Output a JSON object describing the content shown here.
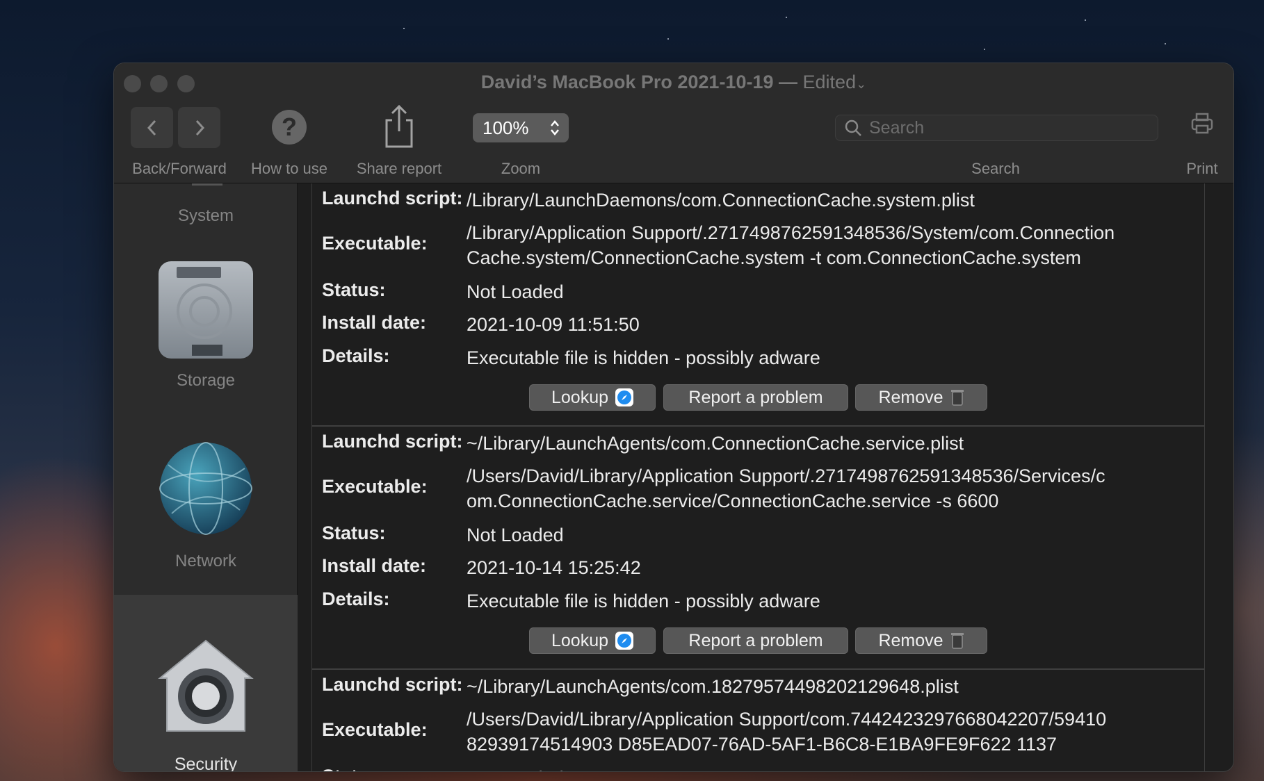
{
  "window": {
    "title": "David’s MacBook Pro 2021-10-19",
    "title_separator": "—",
    "edited_label": "Edited"
  },
  "toolbar": {
    "back_forward_label": "Back/Forward",
    "help_label": "How to use",
    "share_label": "Share report",
    "zoom_label": "Zoom",
    "zoom_value": "100%",
    "search_label": "Search",
    "search_placeholder": "Search",
    "print_label": "Print"
  },
  "sidebar": {
    "items": [
      {
        "label": "System",
        "icon": "system-icon"
      },
      {
        "label": "Storage",
        "icon": "hard-drive-icon"
      },
      {
        "label": "Network",
        "icon": "globe-icon"
      },
      {
        "label": "Security",
        "icon": "security-house-icon",
        "selected": true
      }
    ]
  },
  "labels": {
    "launchd_script": "Launchd script:",
    "executable": "Executable:",
    "status": "Status:",
    "install_date": "Install date:",
    "details": "Details:"
  },
  "buttons": {
    "lookup": "Lookup",
    "report": "Report a problem",
    "remove": "Remove"
  },
  "entries": [
    {
      "launchd_script": "/Library/LaunchDaemons/com.ConnectionCache.system.plist",
      "executable_line1": "/Library/Application Support/.2717498762591348536/System/com.Connection",
      "executable_line2": "Cache.system/ConnectionCache.system -t com.ConnectionCache.system",
      "status": "Not Loaded",
      "install_date": "2021-10-09 11:51:50",
      "details": "Executable file is hidden - possibly adware"
    },
    {
      "launchd_script": "~/Library/LaunchAgents/com.ConnectionCache.service.plist",
      "executable_line1": "/Users/David/Library/Application Support/.2717498762591348536/Services/c",
      "executable_line2": "om.ConnectionCache.service/ConnectionCache.service -s 6600",
      "status": "Not Loaded",
      "install_date": "2021-10-14 15:25:42",
      "details": "Executable file is hidden - possibly adware"
    },
    {
      "launchd_script": "~/Library/LaunchAgents/com.1827957449820212964​8.plist",
      "executable_line1": "/Users/David/Library/Application Support/com.7442423297668042207/59410",
      "executable_line2": "82939174514903 D85EAD07-76AD-5AF1-B6C8-E1BA9FE9F622 1137",
      "status": "Not Loaded"
    }
  ]
}
